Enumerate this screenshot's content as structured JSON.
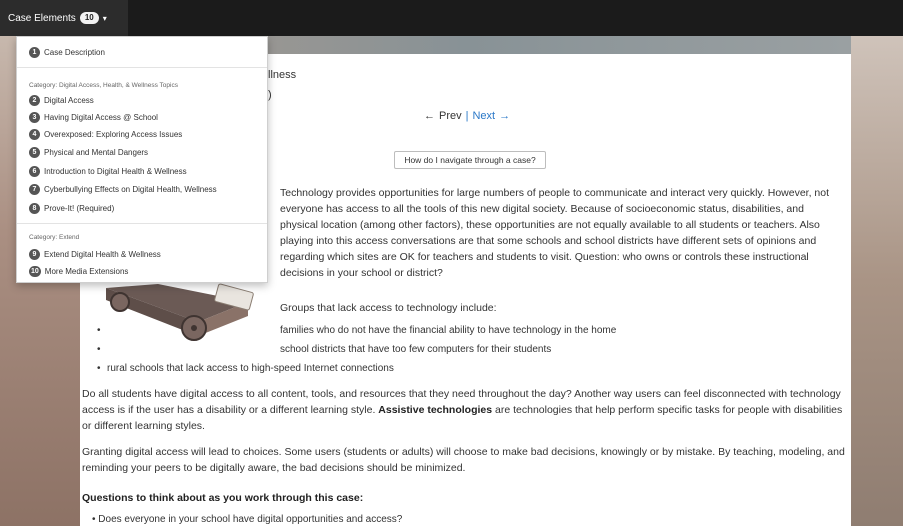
{
  "topbar": {
    "label": "Case Elements",
    "count": "10",
    "caret": "▾"
  },
  "header": {
    "line1": "llness",
    "line2": ")"
  },
  "nav": {
    "prev_arrow": "←",
    "prev": "Prev",
    "sep": "|",
    "next": "Next",
    "next_arrow": "→"
  },
  "howto": "How do I navigate through a case?",
  "paragraph1": "Technology provides opportunities for large numbers of people to communicate and interact very quickly. However, not everyone has access to all the tools of this new digital society. Because of socioeconomic status, disabilities, and physical location (among other factors), these opportunities are not equally available to all students or teachers. Also playing into this access conversations are that some schools and school districts have different sets of opinions and regarding which sites are OK for teachers and students to visit. Question: who owns or controls these instructional decisions in your school or district?",
  "groups_title": "Groups that lack access to technology include:",
  "groups": [
    "families who do not have the financial ability to have technology in the home",
    "school districts that have too few computers for their students",
    "rural schools that lack access to high-speed Internet connections"
  ],
  "bullet": "•",
  "paragraph2_a": "Do all students have digital access to all content, tools, and resources that they need throughout the day?  Another way users can feel disconnected with technology access is if the user has a disability or a different learning style.  ",
  "paragraph2_bold": "Assistive technologies",
  "paragraph2_b": " are technologies that help perform specific tasks for people with disabilities or different learning styles.",
  "paragraph3": "Granting digital access will lead to choices.  Some users (students or adults) will choose to make bad decisions, knowingly or by mistake.  By teaching, modeling, and reminding your peers to be digitally aware, the bad decisions should be minimized.",
  "questions_title": "Questions to think about as you work through this case:",
  "questions": [
    "Does everyone in your school have digital opportunities and access?"
  ],
  "dropdown": {
    "item1": {
      "num": "1",
      "label": "Case Description"
    },
    "category1": "Category: Digital Access, Health, & Wellness Topics",
    "topics": [
      {
        "num": "2",
        "label": "Digital Access"
      },
      {
        "num": "3",
        "label": "Having Digital Access @ School"
      },
      {
        "num": "4",
        "label": "Overexposed: Exploring Access Issues"
      },
      {
        "num": "5",
        "label": "Physical and Mental Dangers"
      },
      {
        "num": "6",
        "label": "Introduction to Digital Health & Wellness"
      },
      {
        "num": "7",
        "label": "Cyberbullying Effects on Digital Health, Wellness"
      },
      {
        "num": "8",
        "label": "Prove-It! (Required)"
      }
    ],
    "category2": "Category: Extend",
    "extend": [
      {
        "num": "9",
        "label": "Extend Digital Health & Wellness"
      },
      {
        "num": "10",
        "label": "More Media Extensions"
      }
    ]
  },
  "colors": {
    "accent_link": "#2a78c8",
    "topbar": "#1b1b1b",
    "badge": "#555555"
  }
}
